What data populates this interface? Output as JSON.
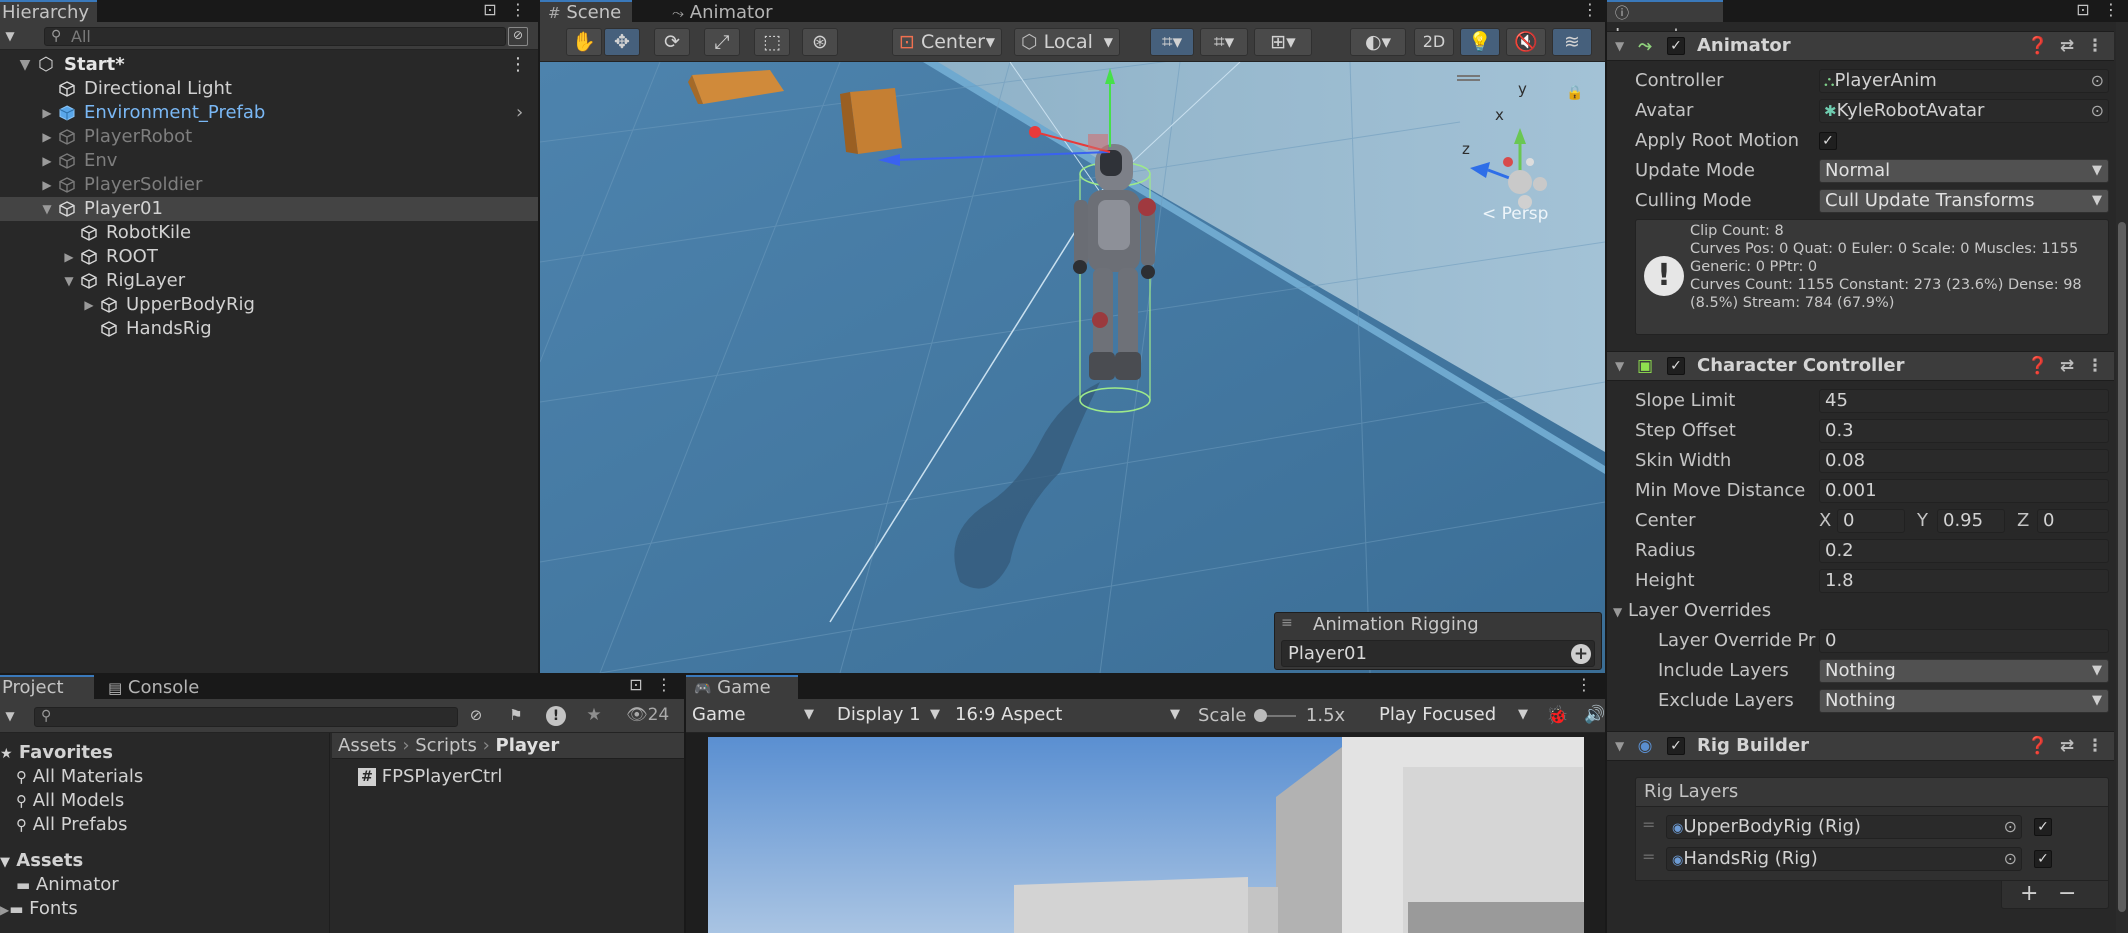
{
  "colors": {
    "accent": "#3a79bb",
    "selection": "#444444",
    "prefab_text": "#7ab8f5"
  },
  "hierarchy": {
    "tab": "Hierarchy",
    "search_placeholder": "All",
    "scene_name": "Start*",
    "items": [
      {
        "label": "Directional Light"
      },
      {
        "label": "Environment_Prefab"
      },
      {
        "label": "PlayerRobot"
      },
      {
        "label": "Env"
      },
      {
        "label": "PlayerSoldier"
      },
      {
        "label": "Player01"
      },
      {
        "label": "RobotKile"
      },
      {
        "label": "ROOT"
      },
      {
        "label": "RigLayer"
      },
      {
        "label": "UpperBodyRig"
      },
      {
        "label": "HandsRig"
      }
    ]
  },
  "scene": {
    "tabs": [
      "Scene",
      "Animator"
    ],
    "toolbar": {
      "pivot": "Center",
      "space": "Local",
      "mode_2d": "2D"
    },
    "persp_label": "< Persp",
    "gizmo_axes": {
      "y": "y",
      "x": "x",
      "z": "z"
    },
    "overlay": {
      "title": "Animation Rigging",
      "value": "Player01"
    }
  },
  "project": {
    "tabs": [
      "Project",
      "Console"
    ],
    "hidden_count": "24",
    "favorites": {
      "title": "Favorites",
      "items": [
        "All Materials",
        "All Models",
        "All Prefabs"
      ]
    },
    "assets": {
      "title": "Assets",
      "items": [
        "Animator",
        "Fonts"
      ]
    },
    "breadcrumb": [
      "Assets",
      "Scripts",
      "Player"
    ],
    "files": [
      "FPSPlayerCtrl"
    ]
  },
  "game": {
    "tab": "Game",
    "view": "Game",
    "display": "Display 1",
    "aspect": "16:9 Aspect",
    "scale_label": "Scale",
    "scale_value": "1.5x",
    "play_mode": "Play Focused"
  },
  "inspector": {
    "tab": "Inspector",
    "animator": {
      "title": "Animator",
      "controller_label": "Controller",
      "controller_value": "PlayerAnim",
      "avatar_label": "Avatar",
      "avatar_value": "KyleRobotAvatar",
      "apply_root_label": "Apply Root Motion",
      "update_label": "Update Mode",
      "update_value": "Normal",
      "culling_label": "Culling Mode",
      "culling_value": "Cull Update Transforms",
      "info_lines": [
        "Clip Count: 8",
        "Curves Pos: 0 Quat: 0 Euler: 0 Scale: 0 Muscles: 1155",
        "Generic: 0 PPtr: 0",
        "Curves Count: 1155 Constant: 273 (23.6%) Dense: 98",
        "(8.5%) Stream: 784 (67.9%)"
      ]
    },
    "character_controller": {
      "title": "Character Controller",
      "slope_label": "Slope Limit",
      "slope_value": "45",
      "step_label": "Step Offset",
      "step_value": "0.3",
      "skin_label": "Skin Width",
      "skin_value": "0.08",
      "minmove_label": "Min Move Distance",
      "minmove_value": "0.001",
      "center_label": "Center",
      "center_x_label": "X",
      "center_x": "0",
      "center_y_label": "Y",
      "center_y": "0.95",
      "center_z_label": "Z",
      "center_z": "0",
      "radius_label": "Radius",
      "radius_value": "0.2",
      "height_label": "Height",
      "height_value": "1.8",
      "layer_overrides_label": "Layer Overrides",
      "override_priority_label": "Layer Override Pri",
      "override_priority_value": "0",
      "include_label": "Include Layers",
      "include_value": "Nothing",
      "exclude_label": "Exclude Layers",
      "exclude_value": "Nothing"
    },
    "rig_builder": {
      "title": "Rig Builder",
      "list_title": "Rig Layers",
      "layers": [
        "UpperBodyRig (Rig)",
        "HandsRig (Rig)"
      ]
    }
  }
}
